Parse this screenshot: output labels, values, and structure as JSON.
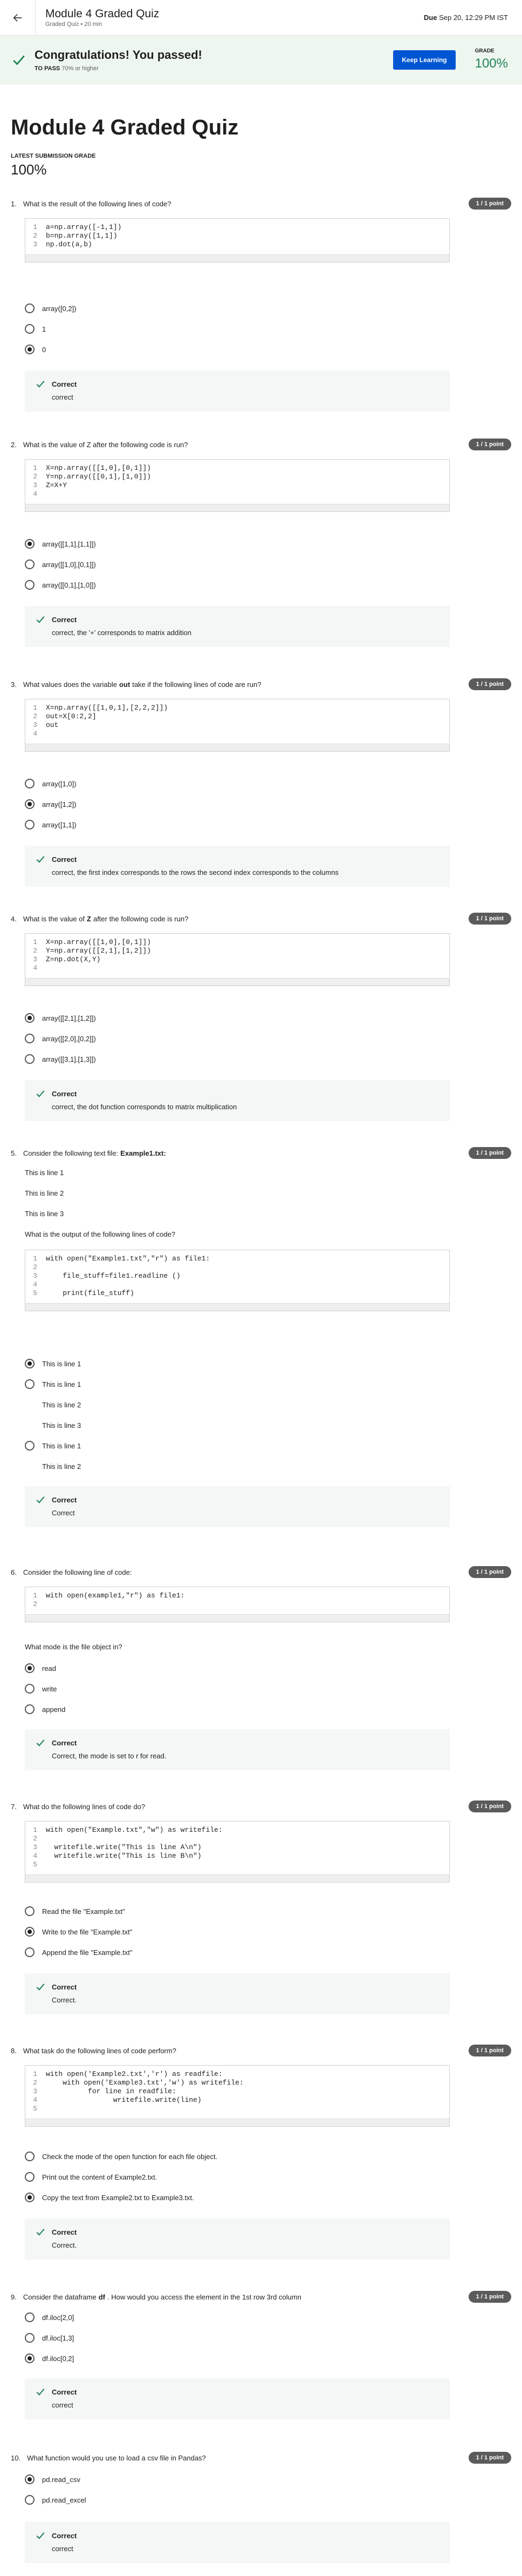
{
  "header": {
    "title": "Module 4 Graded Quiz",
    "subtitle": "Graded Quiz • 20 min",
    "due_label": "Due",
    "due_value": "Sep 20, 12:29 PM IST"
  },
  "banner": {
    "title": "Congratulations! You passed!",
    "to_pass_label": "TO PASS",
    "to_pass_value": "70% or higher",
    "keep_learning": "Keep Learning",
    "grade_label": "GRADE",
    "grade_value": "100%"
  },
  "main": {
    "title": "Module 4 Graded Quiz",
    "latest_label": "LATEST SUBMISSION GRADE",
    "latest_value": "100%"
  },
  "points_label": "1 / 1 point",
  "feedback_label": "Correct",
  "questions": [
    {
      "num": "1.",
      "text": "What is the result of the following lines of code?",
      "code": [
        "a=np.array([-1,1])",
        "b=np.array([1,1])",
        "np.dot(a,b)"
      ],
      "options": [
        "array([0,2])",
        "1",
        "0"
      ],
      "selected": 2,
      "feedback": "correct"
    },
    {
      "num": "2.",
      "text": "What is the value of Z after the following code is run?",
      "code": [
        "X=np.array([[1,0],[0,1]])",
        "Y=np.array([[0,1],[1,0]])",
        "Z=X+Y",
        ""
      ],
      "options": [
        "array([[1,1],[1,1]])",
        "array([[1,0],[0,1]])",
        "array([[0,1],[1,0]])"
      ],
      "selected": 0,
      "feedback": "correct, the '+' corresponds to matrix addition"
    },
    {
      "num": "3.",
      "text_pre": "What values does the variable",
      "text_bold": "out",
      "text_post": "take if the following lines of code are run?",
      "code": [
        "X=np.array([[1,0,1],[2,2,2]])",
        "out=X[0:2,2]",
        "out",
        ""
      ],
      "options": [
        "array([1,0])",
        "array([1,2])",
        "array([1,1])"
      ],
      "selected": 1,
      "feedback": "correct, the first index corresponds to the rows the second index corresponds to the columns"
    },
    {
      "num": "4.",
      "text_pre": "What is the value of",
      "text_bold": "Z",
      "text_post": "after the following code is run?",
      "code": [
        "X=np.array([[1,0],[0,1]])",
        "Y=np.array([[2,1],[1,2]])",
        "Z=np.dot(X,Y)",
        ""
      ],
      "options": [
        "array([[2,1],[1,2]])",
        "array([[2,0],[0,2]])",
        "array([[3,1],[1,3]])"
      ],
      "selected": 0,
      "feedback": "correct, the dot function corresponds to matrix multiplication"
    },
    {
      "num": "5.",
      "text_pre": "Consider the following text file:",
      "text_bold": "Example1.txt:",
      "text_post": "",
      "lines": [
        "This is line 1",
        "This is line 2",
        "This is line 3"
      ],
      "question": "What is the output of the following lines of code?",
      "code": [
        "with open(\"Example1.txt\",\"r\") as file1:",
        "",
        "    file_stuff=file1.readline ()",
        "",
        "    print(file_stuff)"
      ],
      "options": [
        "This is line 1",
        "This is line 1",
        "This is line 1"
      ],
      "extra_lines_b": [
        "This is line 2",
        "This is line 3"
      ],
      "extra_lines_c": [
        "This is line 2"
      ],
      "selected": 0,
      "feedback": "Correct"
    },
    {
      "num": "6.",
      "text": "Consider the following line of code:",
      "code": [
        "with open(example1,\"r\") as file1:",
        ""
      ],
      "question": "What mode is the file object in?",
      "options": [
        "read",
        "write",
        "append"
      ],
      "selected": 0,
      "feedback": "Correct, the mode is set to r for read."
    },
    {
      "num": "7.",
      "text": "What do the following lines of code do?",
      "code": [
        "with open(\"Example.txt\",\"w\") as writefile:",
        "",
        "  writefile.write(\"This is line A\\n\")",
        "  writefile.write(\"This is line B\\n\")",
        ""
      ],
      "options": [
        "Read the file \"Example.txt\"",
        "Write to the file \"Example.txt\"",
        "Append the file \"Example.txt\""
      ],
      "selected": 1,
      "feedback": "Correct."
    },
    {
      "num": "8.",
      "text": "What task do the following lines of code perform?",
      "code": [
        "with open('Example2.txt','r') as readfile:",
        "    with open('Example3.txt','w') as writefile:",
        "          for line in readfile:",
        "                writefile.write(line)",
        ""
      ],
      "options": [
        "Check the mode of the open function for each file object.",
        "Print out the content of Example2.txt.",
        "Copy the text from Example2.txt to Example3.txt."
      ],
      "selected": 2,
      "feedback": "Correct."
    },
    {
      "num": "9.",
      "text_pre": "Consider the dataframe",
      "text_bold": "df",
      "text_post": ". How would you access the element in the 1st row 3rd column",
      "options": [
        "df.iloc[2,0]",
        "df.iloc[1,3]",
        "df.iloc[0,2]"
      ],
      "selected": 2,
      "feedback": "correct"
    },
    {
      "num": "10.",
      "text": "What function would you use to load a csv file in Pandas?",
      "options": [
        "pd.read_csv",
        "pd.read_excel"
      ],
      "selected": 0,
      "feedback": "correct"
    }
  ]
}
